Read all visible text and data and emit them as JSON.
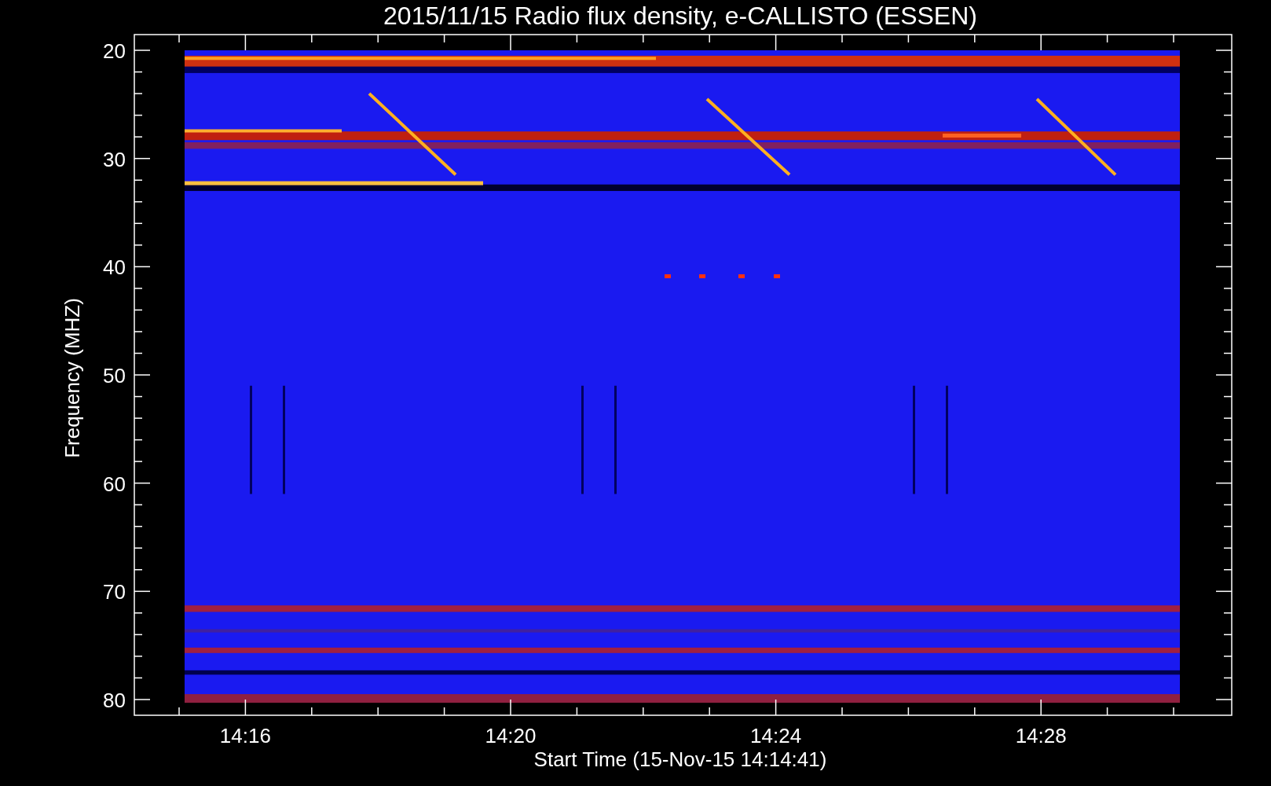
{
  "title": "2015/11/15  Radio flux density, e-CALLISTO (ESSEN)",
  "y_axis": {
    "label": "Frequency (MHZ)",
    "ticks": [
      "20",
      "30",
      "40",
      "50",
      "60",
      "70",
      "80"
    ]
  },
  "x_axis": {
    "label": "Start Time (15-Nov-15 14:14:41)",
    "ticks": [
      "14:16",
      "14:20",
      "14:24",
      "14:28"
    ]
  }
}
